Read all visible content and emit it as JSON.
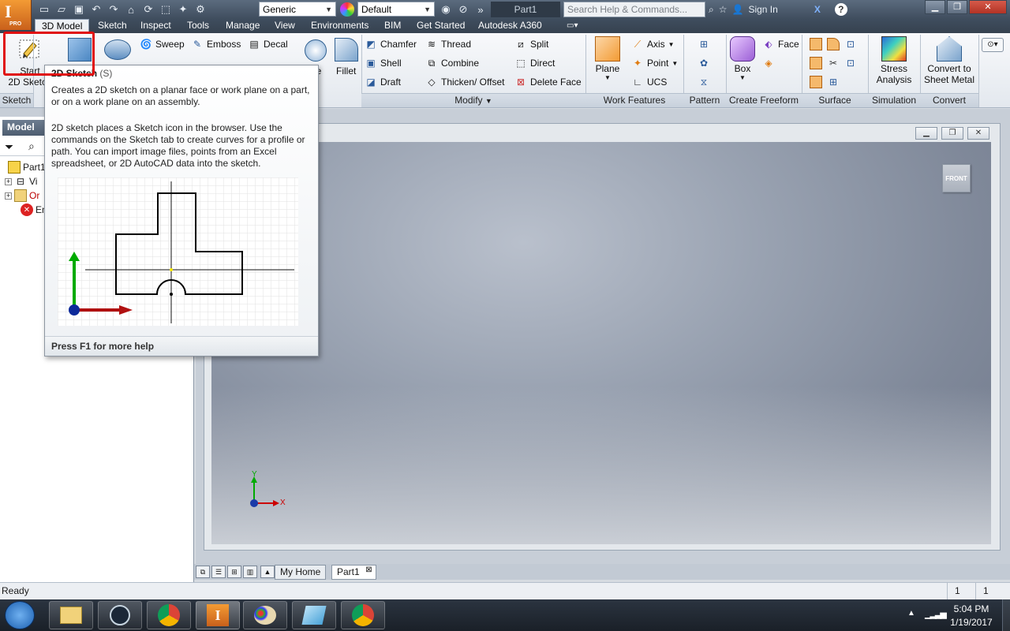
{
  "titlebar": {
    "app_badge": "PRO",
    "material_value": "Generic",
    "appearance_value": "Default",
    "document_title": "Part1",
    "search_placeholder": "Search Help & Commands...",
    "sign_in": "Sign In"
  },
  "tabs": [
    "3D Model",
    "Sketch",
    "Inspect",
    "Tools",
    "Manage",
    "View",
    "Environments",
    "BIM",
    "Get Started",
    "Autodesk A360"
  ],
  "ribbon": {
    "sketch_panel": {
      "start_label": "Start",
      "sketch_label": "2D Sketch",
      "panel_title": "Sketch"
    },
    "create": {
      "sweep": "Sweep",
      "emboss": "Emboss",
      "decal": "Decal",
      "hole_partial": "le",
      "fillet": "Fillet"
    },
    "modify": {
      "chamfer": "Chamfer",
      "thread": "Thread",
      "split": "Split",
      "shell": "Shell",
      "combine": "Combine",
      "direct": "Direct",
      "draft": "Draft",
      "thicken": "Thicken/ Offset",
      "delete_face": "Delete Face",
      "panel_title": "Modify"
    },
    "work_features": {
      "plane": "Plane",
      "axis": "Axis",
      "point": "Point",
      "ucs": "UCS",
      "panel_title": "Work Features"
    },
    "pattern": {
      "panel_title": "Pattern"
    },
    "freeform": {
      "box": "Box",
      "face": "Face",
      "panel_title": "Create Freeform"
    },
    "surface": {
      "panel_title": "Surface"
    },
    "simulation": {
      "stress_line1": "Stress",
      "stress_line2": "Analysis",
      "panel_title": "Simulation"
    },
    "convert": {
      "line1": "Convert to",
      "line2": "Sheet Metal",
      "panel_title": "Convert"
    }
  },
  "browser": {
    "header": "Model",
    "items": [
      {
        "label": "Part1"
      },
      {
        "label": "Vi"
      },
      {
        "label": "Or"
      },
      {
        "label": "En"
      }
    ]
  },
  "tooltip": {
    "title": "2D Sketch",
    "shortcut": "(S)",
    "desc1": "Creates a 2D sketch on a planar face or work plane on a part, or on a work plane on an assembly.",
    "desc2": "2D sketch places a Sketch icon in the browser. Use the commands on the Sketch tab to create curves for a profile or path. You can import image files, points from an Excel spreadsheet, or 2D AutoCAD data into the sketch.",
    "footer": "Press F1 for more help"
  },
  "viewport": {
    "viewcube_face": "FRONT",
    "axis_x": "X",
    "axis_y": "Y"
  },
  "doc_tabs": [
    "My Home",
    "Part1"
  ],
  "status": {
    "text": "Ready",
    "count1": "1",
    "count2": "1"
  },
  "taskbar": {
    "time": "5:04 PM",
    "date": "1/19/2017"
  },
  "colors": {
    "accent_orange": "#f39b34",
    "highlight_red": "#e01010",
    "ribbon_bg": "#eef1f5"
  }
}
